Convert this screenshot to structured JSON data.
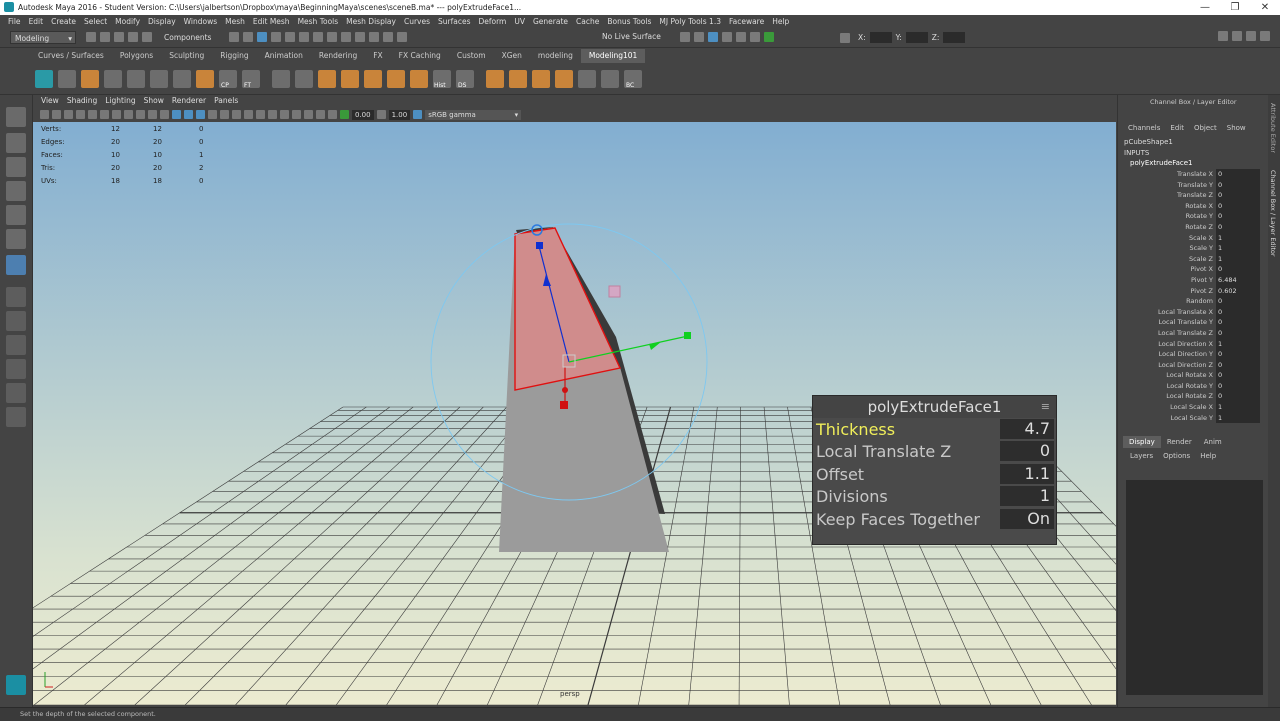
{
  "titlebar": {
    "title": "Autodesk Maya 2016 - Student Version: C:\\Users\\jalbertson\\Dropbox\\maya\\BeginningMaya\\scenes\\sceneB.ma*    ---    polyExtrudeFace1...",
    "minimize": "—",
    "maximize": "❐",
    "close": "✕"
  },
  "menubar": {
    "items": [
      "File",
      "Edit",
      "Create",
      "Select",
      "Modify",
      "Display",
      "Windows",
      "Mesh",
      "Edit Mesh",
      "Mesh Tools",
      "Mesh Display",
      "Curves",
      "Surfaces",
      "Deform",
      "UV",
      "Generate",
      "Cache",
      "Bonus Tools",
      "MJ Poly Tools 1.3",
      "Faceware",
      "Help"
    ]
  },
  "statusline": {
    "mode": "Modeling",
    "components_label": "Components",
    "live_surface": "No Live Surface",
    "x_label": "X:",
    "y_label": "Y:",
    "z_label": "Z:"
  },
  "shelf": {
    "tabs": [
      "Curves / Surfaces",
      "Polygons",
      "Sculpting",
      "Rigging",
      "Animation",
      "Rendering",
      "FX",
      "FX Caching",
      "Custom",
      "XGen",
      "modeling",
      "Modeling101"
    ],
    "active_tab": "Modeling101",
    "labels": [
      "CP",
      "FT",
      "Hist",
      "DS",
      "BC"
    ]
  },
  "viewport": {
    "menu": [
      "View",
      "Shading",
      "Lighting",
      "Show",
      "Renderer",
      "Panels"
    ],
    "field_a": "0.00",
    "field_b": "1.00",
    "color_space": "sRGB gamma",
    "camera_label": "persp",
    "hud": {
      "rows": [
        {
          "label": "Verts:",
          "a": "12",
          "b": "12",
          "c": "0"
        },
        {
          "label": "Edges:",
          "a": "20",
          "b": "20",
          "c": "0"
        },
        {
          "label": "Faces:",
          "a": "10",
          "b": "10",
          "c": "1"
        },
        {
          "label": "Tris:",
          "a": "20",
          "b": "20",
          "c": "2"
        },
        {
          "label": "UVs:",
          "a": "18",
          "b": "18",
          "c": "0"
        }
      ]
    }
  },
  "in_view_editor": {
    "title": "polyExtrudeFace1",
    "rows": [
      {
        "label": "Thickness",
        "value": "4.7"
      },
      {
        "label": "Local Translate Z",
        "value": "0"
      },
      {
        "label": "Offset",
        "value": "1.1"
      },
      {
        "label": "Divisions",
        "value": "1"
      },
      {
        "label": "Keep Faces Together",
        "value": "On"
      }
    ]
  },
  "channel_box": {
    "header": "Channel Box / Layer Editor",
    "menu": [
      "Channels",
      "Edit",
      "Object",
      "Show"
    ],
    "shape": "pCubeShape1",
    "inputs_label": "INPUTS",
    "node": "polyExtrudeFace1",
    "attributes": [
      {
        "name": "Translate X",
        "value": "0"
      },
      {
        "name": "Translate Y",
        "value": "0"
      },
      {
        "name": "Translate Z",
        "value": "0"
      },
      {
        "name": "Rotate X",
        "value": "0"
      },
      {
        "name": "Rotate Y",
        "value": "0"
      },
      {
        "name": "Rotate Z",
        "value": "0"
      },
      {
        "name": "Scale X",
        "value": "1"
      },
      {
        "name": "Scale Y",
        "value": "1"
      },
      {
        "name": "Scale Z",
        "value": "1"
      },
      {
        "name": "Pivot X",
        "value": "0"
      },
      {
        "name": "Pivot Y",
        "value": "6.484"
      },
      {
        "name": "Pivot Z",
        "value": "0.602"
      },
      {
        "name": "Random",
        "value": "0"
      },
      {
        "name": "Local Translate X",
        "value": "0"
      },
      {
        "name": "Local Translate Y",
        "value": "0"
      },
      {
        "name": "Local Translate Z",
        "value": "0"
      },
      {
        "name": "Local Direction X",
        "value": "1"
      },
      {
        "name": "Local Direction Y",
        "value": "0"
      },
      {
        "name": "Local Direction Z",
        "value": "0"
      },
      {
        "name": "Local Rotate X",
        "value": "0"
      },
      {
        "name": "Local Rotate Y",
        "value": "0"
      },
      {
        "name": "Local Rotate Z",
        "value": "0"
      },
      {
        "name": "Local Scale X",
        "value": "1"
      },
      {
        "name": "Local Scale Y",
        "value": "1"
      }
    ],
    "layer_tabs": [
      "Display",
      "Render",
      "Anim"
    ],
    "layer_menu": [
      "Layers",
      "Options",
      "Help"
    ]
  },
  "right_strip": {
    "attribute_editor": "Attribute Editor",
    "channel_box_tab": "Channel Box / Layer Editor"
  },
  "helpline": {
    "text": "Set the depth of the selected component."
  },
  "colors": {
    "selected_face": "#d98a8a",
    "selection_edge": "#e01010",
    "highlight_label": "#f0ee5a",
    "manip_blue": "#1030d0",
    "manip_green": "#10d020",
    "manip_red": "#d01010"
  }
}
